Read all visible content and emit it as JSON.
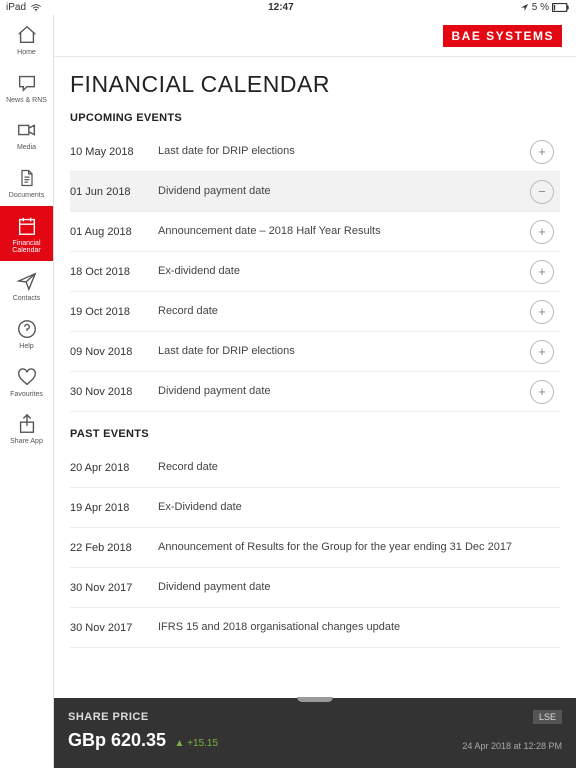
{
  "status": {
    "device": "iPad",
    "time": "12:47",
    "battery": "5 %"
  },
  "logo": "BAE SYSTEMS",
  "sidebar": [
    {
      "label": "Home"
    },
    {
      "label": "News & RNS"
    },
    {
      "label": "Media"
    },
    {
      "label": "Documents"
    },
    {
      "label": "Financial\nCalendar"
    },
    {
      "label": "Contacts"
    },
    {
      "label": "Help"
    },
    {
      "label": "Favourites"
    },
    {
      "label": "Share App"
    }
  ],
  "page_title": "FINANCIAL CALENDAR",
  "sections": {
    "upcoming": {
      "title": "UPCOMING EVENTS",
      "items": [
        {
          "date": "10 May 2018",
          "desc": "Last date for DRIP elections",
          "btn": "+"
        },
        {
          "date": "01 Jun 2018",
          "desc": "Dividend payment date",
          "btn": "−",
          "hl": true
        },
        {
          "date": "01 Aug 2018",
          "desc": "Announcement date – 2018 Half Year Results",
          "btn": "+"
        },
        {
          "date": "18 Oct 2018",
          "desc": "Ex-dividend date",
          "btn": "+"
        },
        {
          "date": "19 Oct 2018",
          "desc": "Record date",
          "btn": "+"
        },
        {
          "date": "09 Nov 2018",
          "desc": "Last date for DRIP elections",
          "btn": "+"
        },
        {
          "date": "30 Nov 2018",
          "desc": "Dividend payment date",
          "btn": "+"
        }
      ]
    },
    "past": {
      "title": "PAST EVENTS",
      "items": [
        {
          "date": "20 Apr 2018",
          "desc": "Record date"
        },
        {
          "date": "19 Apr 2018",
          "desc": "Ex-Dividend date"
        },
        {
          "date": "22 Feb 2018",
          "desc": "Announcement of Results for the Group for the year ending 31 Dec 2017"
        },
        {
          "date": "30 Nov 2017",
          "desc": "Dividend payment date"
        },
        {
          "date": "30 Nov 2017",
          "desc": "IFRS 15 and 2018 organisational changes update"
        }
      ]
    }
  },
  "footer": {
    "label": "SHARE PRICE",
    "exchange": "LSE",
    "price": "GBp 620.35",
    "change": "▲ +15.15",
    "timestamp": "24 Apr 2018 at 12:28 PM"
  }
}
